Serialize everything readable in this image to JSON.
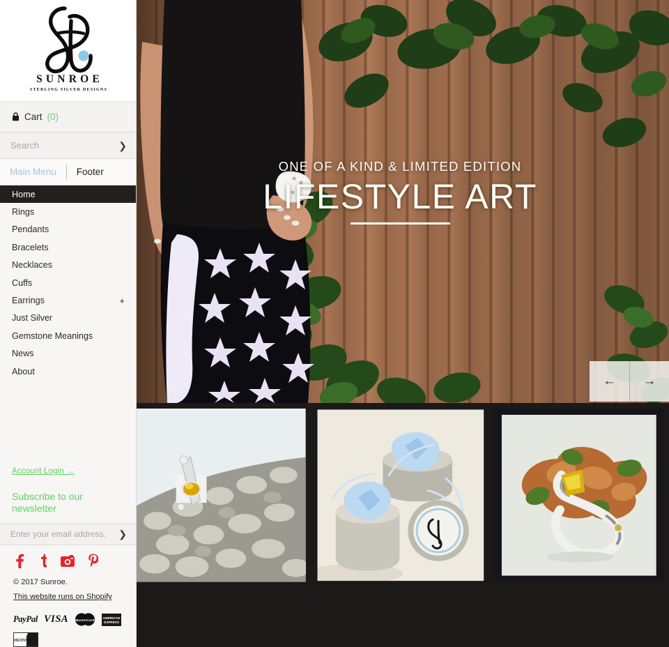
{
  "brand": {
    "wordmark": "SUNROE",
    "tagline": "STERLING SILVER DESIGNS",
    "logo_icon": "sunroe-script-monogram-icon",
    "logo_dot_color": "#8ec8ea"
  },
  "sidebar": {
    "cart": {
      "icon": "lock-icon",
      "label": "Cart",
      "count": "(0)",
      "count_color": "#6fce78"
    },
    "search": {
      "placeholder": "Search",
      "value": "",
      "submit_icon": "chevron-right-icon"
    },
    "menu_tabs": [
      {
        "label": "Main Menu",
        "active": true
      },
      {
        "label": "Footer",
        "active": false
      }
    ],
    "nav": [
      {
        "label": "Home",
        "current": true,
        "expander": ""
      },
      {
        "label": "Rings",
        "current": false,
        "expander": ""
      },
      {
        "label": "Pendants",
        "current": false,
        "expander": ""
      },
      {
        "label": "Bracelets",
        "current": false,
        "expander": ""
      },
      {
        "label": "Necklaces",
        "current": false,
        "expander": ""
      },
      {
        "label": "Cuffs",
        "current": false,
        "expander": ""
      },
      {
        "label": "Earrings",
        "current": false,
        "expander": "+"
      },
      {
        "label": "Just Silver",
        "current": false,
        "expander": ""
      },
      {
        "label": "Gemstone Meanings",
        "current": false,
        "expander": ""
      },
      {
        "label": "News",
        "current": false,
        "expander": ""
      },
      {
        "label": "About",
        "current": false,
        "expander": ""
      }
    ],
    "account_login": "Account Login →",
    "account_login_color": "#5fcf5f",
    "newsletter": {
      "heading": "Subscribe to our newsletter",
      "heading_color": "#5ed35e",
      "placeholder": "Enter your email address.",
      "value": "",
      "submit_icon": "chevron-right-icon"
    },
    "socials": [
      {
        "name": "facebook-icon",
        "glyph": "f"
      },
      {
        "name": "tumblr-icon",
        "glyph": "t"
      },
      {
        "name": "instagram-icon",
        "glyph": "camera"
      },
      {
        "name": "pinterest-icon",
        "glyph": "P"
      }
    ],
    "social_color": "#e8232a",
    "copyright": "© 2017 Sunroe.",
    "copyright_link_text": "Sunroe.",
    "powered_by": "This website runs on Shopify",
    "payments": [
      {
        "name": "paypal-badge",
        "label": "PayPal"
      },
      {
        "name": "visa-badge",
        "label": "VISA"
      },
      {
        "name": "mastercard-badge",
        "label": "MasterCard"
      },
      {
        "name": "amex-badge",
        "label": "AMERICAN EXPRESS"
      },
      {
        "name": "discover-badge",
        "label": "DISCOVER"
      }
    ]
  },
  "hero": {
    "kicker": "ONE OF A KIND & LIMITED EDITION",
    "title": "LIFESTYLE ART",
    "image_alt": "model in black top and star-print pants wearing silver cuff and rings against a wooden fence with green vines",
    "prev_icon": "arrow-left-icon",
    "next_icon": "arrow-right-icon"
  },
  "products": [
    {
      "name": "product-tile-1",
      "alt": "silver ring with yellow citrine gemstone resting on grey quartz crystal"
    },
    {
      "name": "product-tile-2",
      "alt": "silver gift tins with pale blue satin pouches and logo-stamped lid"
    },
    {
      "name": "product-tile-3",
      "alt": "sculptural silver ring with yellow gem on copper and green mineral"
    }
  ]
}
